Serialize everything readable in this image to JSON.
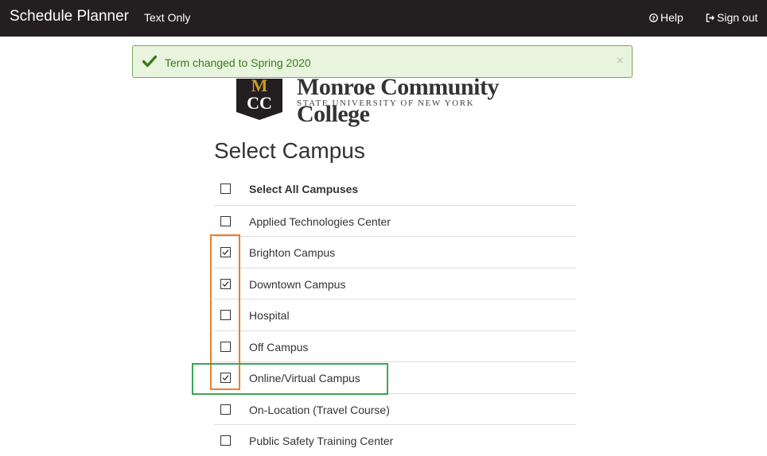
{
  "nav": {
    "brand": "Schedule Planner",
    "text_only": "Text Only",
    "help": "Help",
    "sign_out": "Sign out",
    "help_icon": "question-circle-icon",
    "sign_out_icon": "sign-out-icon"
  },
  "alert": {
    "message": "Term changed to Spring 2020",
    "close": "×",
    "icon": "check-icon"
  },
  "logo": {
    "name": "Monroe Community College",
    "subtitle": "STATE UNIVERSITY OF NEW YORK",
    "mark_letters": "MCC"
  },
  "page": {
    "title": "Select Campus"
  },
  "campuses": {
    "select_all": {
      "label": "Select All Campuses",
      "checked": false
    },
    "items": [
      {
        "label": "Applied Technologies Center",
        "checked": false
      },
      {
        "label": "Brighton Campus",
        "checked": true
      },
      {
        "label": "Downtown Campus",
        "checked": true
      },
      {
        "label": "Hospital",
        "checked": false
      },
      {
        "label": "Off Campus",
        "checked": false
      },
      {
        "label": "Online/Virtual Campus",
        "checked": true
      },
      {
        "label": "On-Location (Travel Course)",
        "checked": false
      },
      {
        "label": "Public Safety Training Center",
        "checked": false
      }
    ]
  },
  "colors": {
    "navbar": "#231f20",
    "alert_bg": "#e8f4de",
    "alert_text": "#3b7a1f",
    "logo_shield": "#231f20",
    "logo_gold": "#c99a2e",
    "highlight_orange": "#e8812e",
    "highlight_green": "#3aa655"
  }
}
